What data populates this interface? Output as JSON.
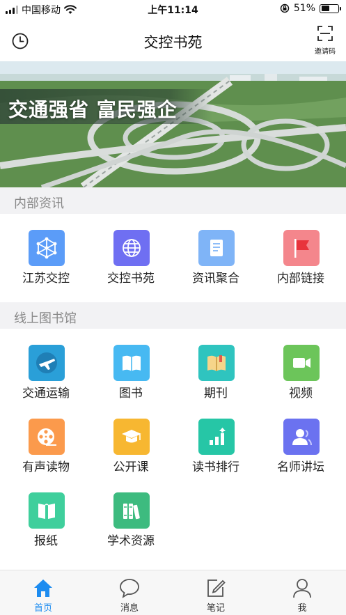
{
  "status_bar": {
    "carrier": "中国移动",
    "time": "上午11:14",
    "battery_percent": "51%",
    "battery_level": 0.51,
    "icons": [
      "signal-icon",
      "wifi-icon",
      "orientation-lock-icon",
      "battery-icon"
    ]
  },
  "nav": {
    "title": "交控书苑",
    "invite_label": "邀请码",
    "icons": [
      "clock-history-icon",
      "scan-qr-icon"
    ]
  },
  "banner": {
    "slogan": "交通强省 富民强企",
    "colors": {
      "sky": "#d8e8ee",
      "green": "#4f7d3f"
    }
  },
  "sections": {
    "internal": {
      "title": "内部资讯",
      "items": [
        {
          "label": "江苏交控",
          "icon": "network-icon",
          "color": "#5b9cf8"
        },
        {
          "label": "交控书苑",
          "icon": "globe-icon",
          "color": "#6f6ff2"
        },
        {
          "label": "资讯聚合",
          "icon": "document-icon",
          "color": "#7fb4f7"
        },
        {
          "label": "内部链接",
          "icon": "flag-icon",
          "color": "#f4868c"
        }
      ]
    },
    "library": {
      "title": "线上图书馆",
      "items": [
        {
          "label": "交通运输",
          "icon": "airplane-icon",
          "color": "#2a9fd8"
        },
        {
          "label": "图书",
          "icon": "book-icon",
          "color": "#47b9f2"
        },
        {
          "label": "期刊",
          "icon": "journal-icon",
          "color": "#2fc4bf"
        },
        {
          "label": "视频",
          "icon": "video-camera-icon",
          "color": "#6cc55a"
        },
        {
          "label": "有声读物",
          "icon": "film-reel-icon",
          "color": "#fb9a4c"
        },
        {
          "label": "公开课",
          "icon": "graduation-cap-icon",
          "color": "#f7b731"
        },
        {
          "label": "读书排行",
          "icon": "bar-chart-icon",
          "color": "#26c6a6"
        },
        {
          "label": "名师讲坛",
          "icon": "users-icon",
          "color": "#6b72f0"
        },
        {
          "label": "报纸",
          "icon": "newspaper-icon",
          "color": "#3fcf9c"
        },
        {
          "label": "学术资源",
          "icon": "books-shelf-icon",
          "color": "#3dbb7f"
        }
      ]
    }
  },
  "tab_bar": {
    "active_color": "#1d8cf0",
    "tabs": [
      {
        "label": "首页",
        "icon": "home-icon",
        "active": true
      },
      {
        "label": "消息",
        "icon": "message-icon",
        "active": false
      },
      {
        "label": "笔记",
        "icon": "note-edit-icon",
        "active": false
      },
      {
        "label": "我",
        "icon": "user-icon",
        "active": false
      }
    ]
  }
}
